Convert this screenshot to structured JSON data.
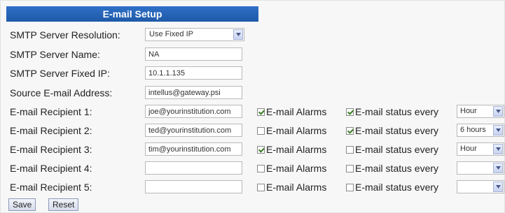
{
  "header": {
    "title": "E-mail Setup"
  },
  "smtp": {
    "resolution_label": "SMTP Server Resolution:",
    "resolution_value": "Use Fixed IP",
    "name_label": "SMTP Server Name:",
    "name_value": "NA",
    "ip_label": "SMTP Server Fixed IP:",
    "ip_value": "10.1.1.135",
    "source_label": "Source E-mail Address:",
    "source_value": "intellus@gateway.psi"
  },
  "recipients": [
    {
      "label": "E-mail Recipient 1:",
      "email": "joe@yourinstitution.com",
      "alarms_checked": true,
      "status_checked": true,
      "interval": "Hour"
    },
    {
      "label": "E-mail Recipient 2:",
      "email": "ted@yourinstitution.com",
      "alarms_checked": false,
      "status_checked": true,
      "interval": "6 hours"
    },
    {
      "label": "E-mail Recipient 3:",
      "email": "tim@yourinstitution.com",
      "alarms_checked": true,
      "status_checked": false,
      "interval": "Hour"
    },
    {
      "label": "E-mail Recipient 4:",
      "email": "",
      "alarms_checked": false,
      "status_checked": false,
      "interval": ""
    },
    {
      "label": "E-mail Recipient 5:",
      "email": "",
      "alarms_checked": false,
      "status_checked": false,
      "interval": ""
    }
  ],
  "labels": {
    "alarms": "E-mail Alarms",
    "status": "E-mail status every"
  },
  "buttons": {
    "save": "Save",
    "reset": "Reset"
  },
  "colors": {
    "header_bg": "#1e5aa8",
    "header_text": "#ffffff",
    "check_mark": "#3a7d23"
  },
  "icons": {
    "dropdown": "chevron-down-icon",
    "checkbox": "checkbox-icon"
  }
}
